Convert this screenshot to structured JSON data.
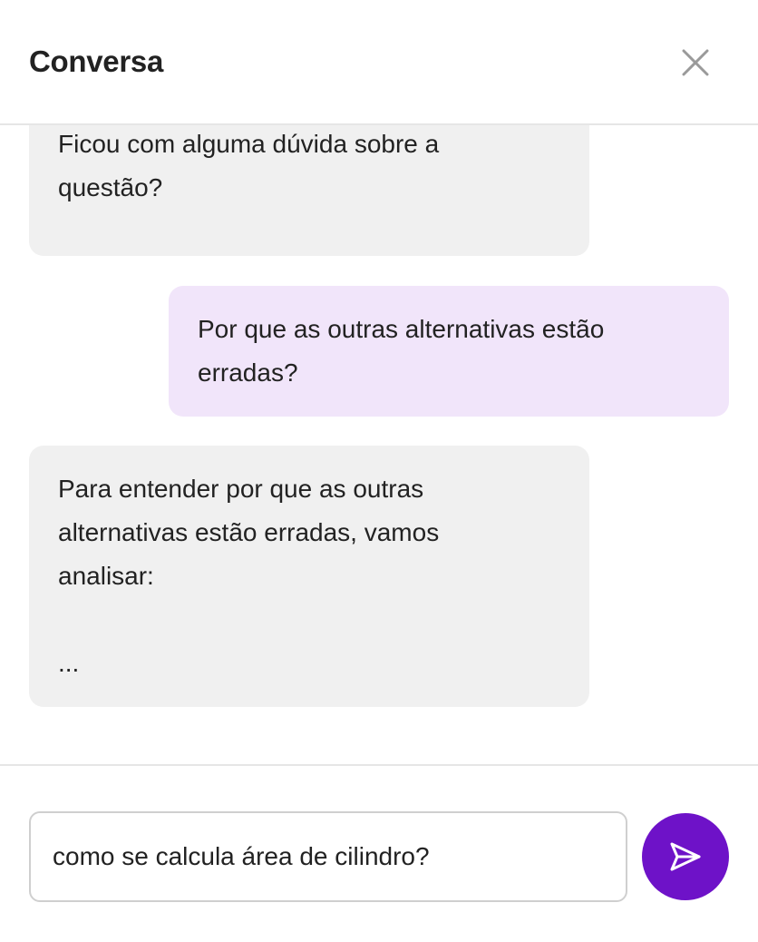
{
  "header": {
    "title": "Conversa",
    "close_icon": "close-icon"
  },
  "messages": [
    {
      "role": "bot",
      "text": "Ficou com alguma dúvida sobre a\nquestão?"
    },
    {
      "role": "user",
      "text": "Por que as outras alternativas estão\nerradas?"
    },
    {
      "role": "bot",
      "text": "Para entender por que as outras\nalternativas estão erradas, vamos\nanalisar:\n\n..."
    }
  ],
  "composer": {
    "value": "como se calcula área de cilindro?",
    "send_icon": "send-icon"
  },
  "colors": {
    "accent": "#6e12c8",
    "user_bubble": "#f1e5fa",
    "bot_bubble": "#f0f0f0",
    "divider": "#e6e6e6"
  }
}
